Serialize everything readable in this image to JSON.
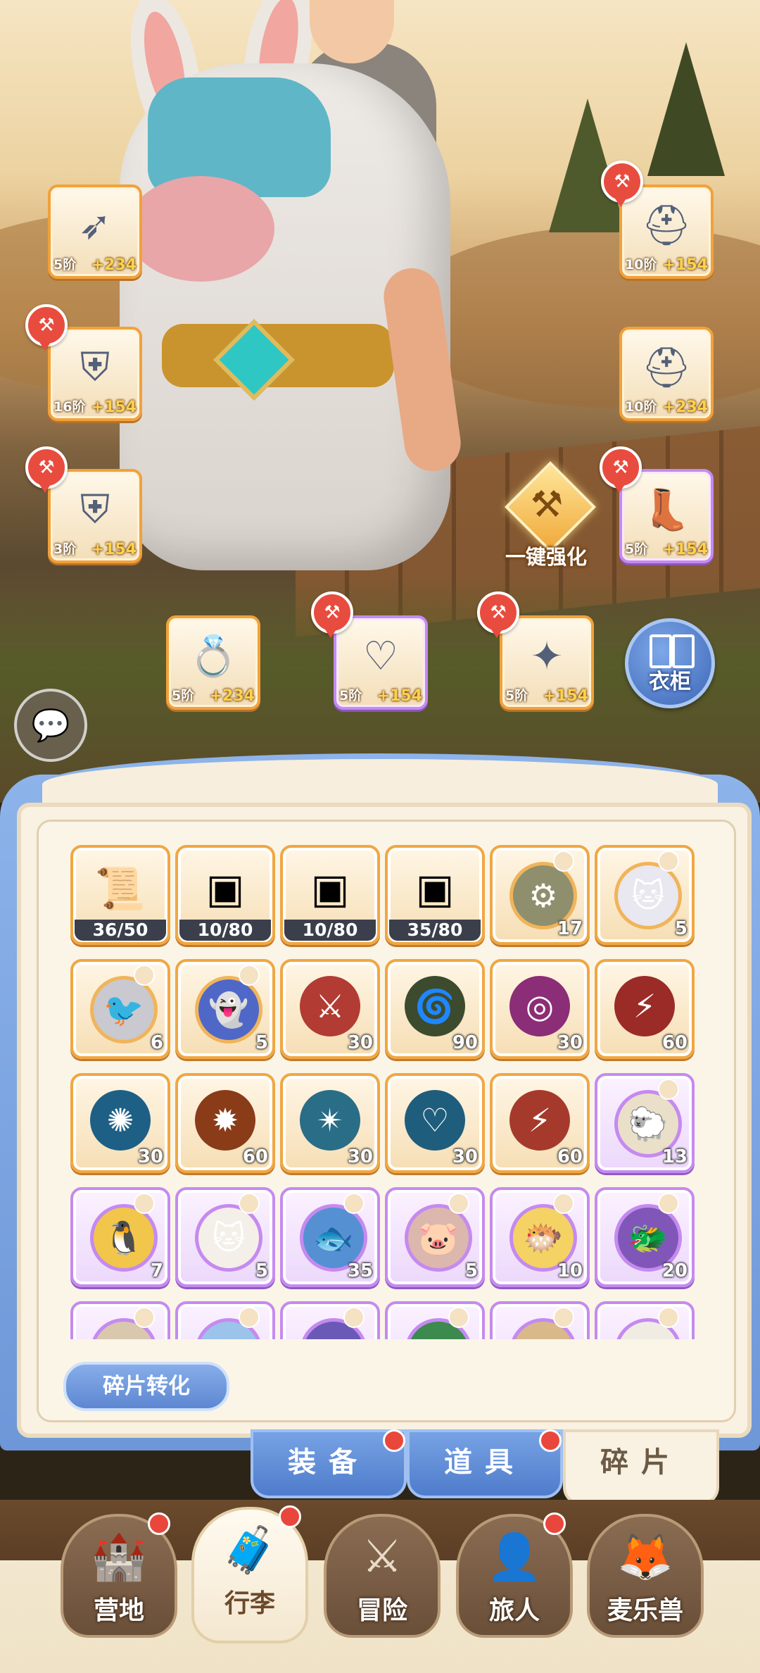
{
  "equipment": [
    {
      "level": "5阶",
      "bonus": "+234",
      "icon": "bow-icon",
      "glyph": "➶",
      "quality": "orange",
      "upgradeable": false
    },
    {
      "level": "10阶",
      "bonus": "+154",
      "icon": "helmet-icon",
      "glyph": "⛑",
      "quality": "orange",
      "upgradeable": true
    },
    {
      "level": "16阶",
      "bonus": "+154",
      "icon": "armor-icon",
      "glyph": "⛨",
      "quality": "orange",
      "upgradeable": true
    },
    {
      "level": "10阶",
      "bonus": "+234",
      "icon": "hat-icon",
      "glyph": "⛑",
      "quality": "orange",
      "upgradeable": false
    },
    {
      "level": "3阶",
      "bonus": "+154",
      "icon": "pants-icon",
      "glyph": "⛨",
      "quality": "orange",
      "upgradeable": true
    },
    {
      "level": "5阶",
      "bonus": "+154",
      "icon": "boots-icon",
      "glyph": "👢",
      "quality": "purple",
      "upgradeable": true
    },
    {
      "level": "5阶",
      "bonus": "+234",
      "icon": "ring-icon",
      "glyph": "💍",
      "quality": "orange",
      "upgradeable": false
    },
    {
      "level": "5阶",
      "bonus": "+154",
      "icon": "necklace-icon",
      "glyph": "♡",
      "quality": "purple",
      "upgradeable": true
    },
    {
      "level": "5阶",
      "bonus": "+154",
      "icon": "amulet-icon",
      "glyph": "✦",
      "quality": "orange",
      "upgradeable": true
    }
  ],
  "enhance_button": {
    "label": "一键强化"
  },
  "wardrobe_button": {
    "label": "衣柜"
  },
  "chat_button": {
    "icon": "chat-bubble-icon"
  },
  "fragments": [
    {
      "icon": "scroll-icon",
      "glyph": "📜",
      "count": "36/50",
      "style": "bar",
      "quality": "orange"
    },
    {
      "icon": "fire-chip-icon",
      "glyph": "▣",
      "count": "10/80",
      "style": "bar",
      "quality": "orange"
    },
    {
      "icon": "mountain-chip-icon",
      "glyph": "▣",
      "count": "10/80",
      "style": "bar",
      "quality": "orange"
    },
    {
      "icon": "tower-chip-icon",
      "glyph": "▣",
      "count": "35/80",
      "style": "bar",
      "quality": "orange"
    },
    {
      "icon": "mech-pet-icon",
      "glyph": "⚙",
      "count": "17",
      "style": "pet",
      "quality": "orange",
      "color": "#8f8f6e"
    },
    {
      "icon": "snow-leopard-icon",
      "glyph": "🐱",
      "count": "5",
      "style": "pet",
      "quality": "orange",
      "color": "#e9e7ef"
    },
    {
      "icon": "grey-bird-icon",
      "glyph": "🐦",
      "count": "6",
      "style": "pet",
      "quality": "orange",
      "color": "#c9c9cf"
    },
    {
      "icon": "blue-spirit-icon",
      "glyph": "👻",
      "count": "5",
      "style": "pet",
      "quality": "orange",
      "color": "#4f68c8"
    },
    {
      "icon": "claw-slash-skill-icon",
      "glyph": "⚔",
      "count": "30",
      "style": "skill",
      "quality": "orange",
      "color": "#b23b33"
    },
    {
      "icon": "vortex-skill-icon",
      "glyph": "🌀",
      "count": "90",
      "style": "skill",
      "quality": "orange",
      "color": "#3c4b2e"
    },
    {
      "icon": "target-skill-icon",
      "glyph": "◎",
      "count": "30",
      "style": "skill",
      "quality": "orange",
      "color": "#8c2d77"
    },
    {
      "icon": "lightning-skill-icon",
      "glyph": "⚡",
      "count": "60",
      "style": "skill",
      "quality": "orange",
      "color": "#9b2b27"
    },
    {
      "icon": "ice-burst-skill-icon",
      "glyph": "✺",
      "count": "30",
      "style": "skill",
      "quality": "orange",
      "color": "#1e5f86"
    },
    {
      "icon": "ground-crack-skill-icon",
      "glyph": "✹",
      "count": "60",
      "style": "skill",
      "quality": "orange",
      "color": "#8a3b18"
    },
    {
      "icon": "star-burst-skill-icon",
      "glyph": "✴",
      "count": "30",
      "style": "skill",
      "quality": "orange",
      "color": "#2a6d86"
    },
    {
      "icon": "heart-skill-icon",
      "glyph": "♡",
      "count": "30",
      "style": "skill",
      "quality": "orange",
      "color": "#1f5d7c"
    },
    {
      "icon": "fire-strike-skill-icon",
      "glyph": "⚡",
      "count": "60",
      "style": "skill",
      "quality": "orange",
      "color": "#a53a2c"
    },
    {
      "icon": "sheep-pet-icon",
      "glyph": "🐑",
      "count": "13",
      "style": "pet",
      "quality": "purple",
      "color": "#eadfc8"
    },
    {
      "icon": "penguin-pet-icon",
      "glyph": "🐧",
      "count": "7",
      "style": "pet",
      "quality": "purple",
      "color": "#f1c64a"
    },
    {
      "icon": "white-cat-pet-icon",
      "glyph": "🐱",
      "count": "5",
      "style": "pet",
      "quality": "purple",
      "color": "#f4efe8"
    },
    {
      "icon": "fish-pet-icon",
      "glyph": "🐟",
      "count": "35",
      "style": "pet",
      "quality": "purple",
      "color": "#5590d3"
    },
    {
      "icon": "pig-pet-icon",
      "glyph": "🐷",
      "count": "5",
      "style": "pet",
      "quality": "purple",
      "color": "#dcb7ad"
    },
    {
      "icon": "puffer-pet-icon",
      "glyph": "🐡",
      "count": "10",
      "style": "pet",
      "quality": "purple",
      "color": "#f4d264"
    },
    {
      "icon": "purple-dragon-pet-icon",
      "glyph": "🐲",
      "count": "20",
      "style": "pet",
      "quality": "purple",
      "color": "#8057b8"
    },
    {
      "icon": "partial-pet-icon",
      "glyph": "",
      "count": "",
      "style": "pet",
      "quality": "purple",
      "color": "#d9c8ae"
    },
    {
      "icon": "partial-pet-icon",
      "glyph": "",
      "count": "",
      "style": "pet",
      "quality": "purple",
      "color": "#9cc3ea"
    },
    {
      "icon": "partial-pet-icon",
      "glyph": "",
      "count": "",
      "style": "pet",
      "quality": "purple",
      "color": "#6a5ab6"
    },
    {
      "icon": "partial-pet-icon",
      "glyph": "",
      "count": "",
      "style": "pet",
      "quality": "purple",
      "color": "#3c8a4e"
    },
    {
      "icon": "partial-pet-icon",
      "glyph": "",
      "count": "",
      "style": "pet",
      "quality": "purple",
      "color": "#d9b98a"
    },
    {
      "icon": "partial-pet-icon",
      "glyph": "",
      "count": "",
      "style": "pet",
      "quality": "purple",
      "color": "#f0ece4"
    }
  ],
  "convert_button": {
    "label": "碎片转化"
  },
  "category_tabs": [
    {
      "label": "装备",
      "active": false,
      "dot": true
    },
    {
      "label": "道具",
      "active": false,
      "dot": true
    },
    {
      "label": "碎片",
      "active": true,
      "dot": false
    }
  ],
  "nav": [
    {
      "label": "营地",
      "icon": "castle-icon",
      "glyph": "🏰",
      "active": false,
      "dot": true
    },
    {
      "label": "行李",
      "icon": "chest-icon",
      "glyph": "🧳",
      "active": true,
      "dot": true
    },
    {
      "label": "冒险",
      "icon": "crossed-swords-icon",
      "glyph": "⚔",
      "active": false,
      "dot": false
    },
    {
      "label": "旅人",
      "icon": "traveler-icon",
      "glyph": "👤",
      "active": false,
      "dot": true
    },
    {
      "label": "麦乐兽",
      "icon": "fox-icon",
      "glyph": "🦊",
      "active": false,
      "dot": false
    }
  ]
}
